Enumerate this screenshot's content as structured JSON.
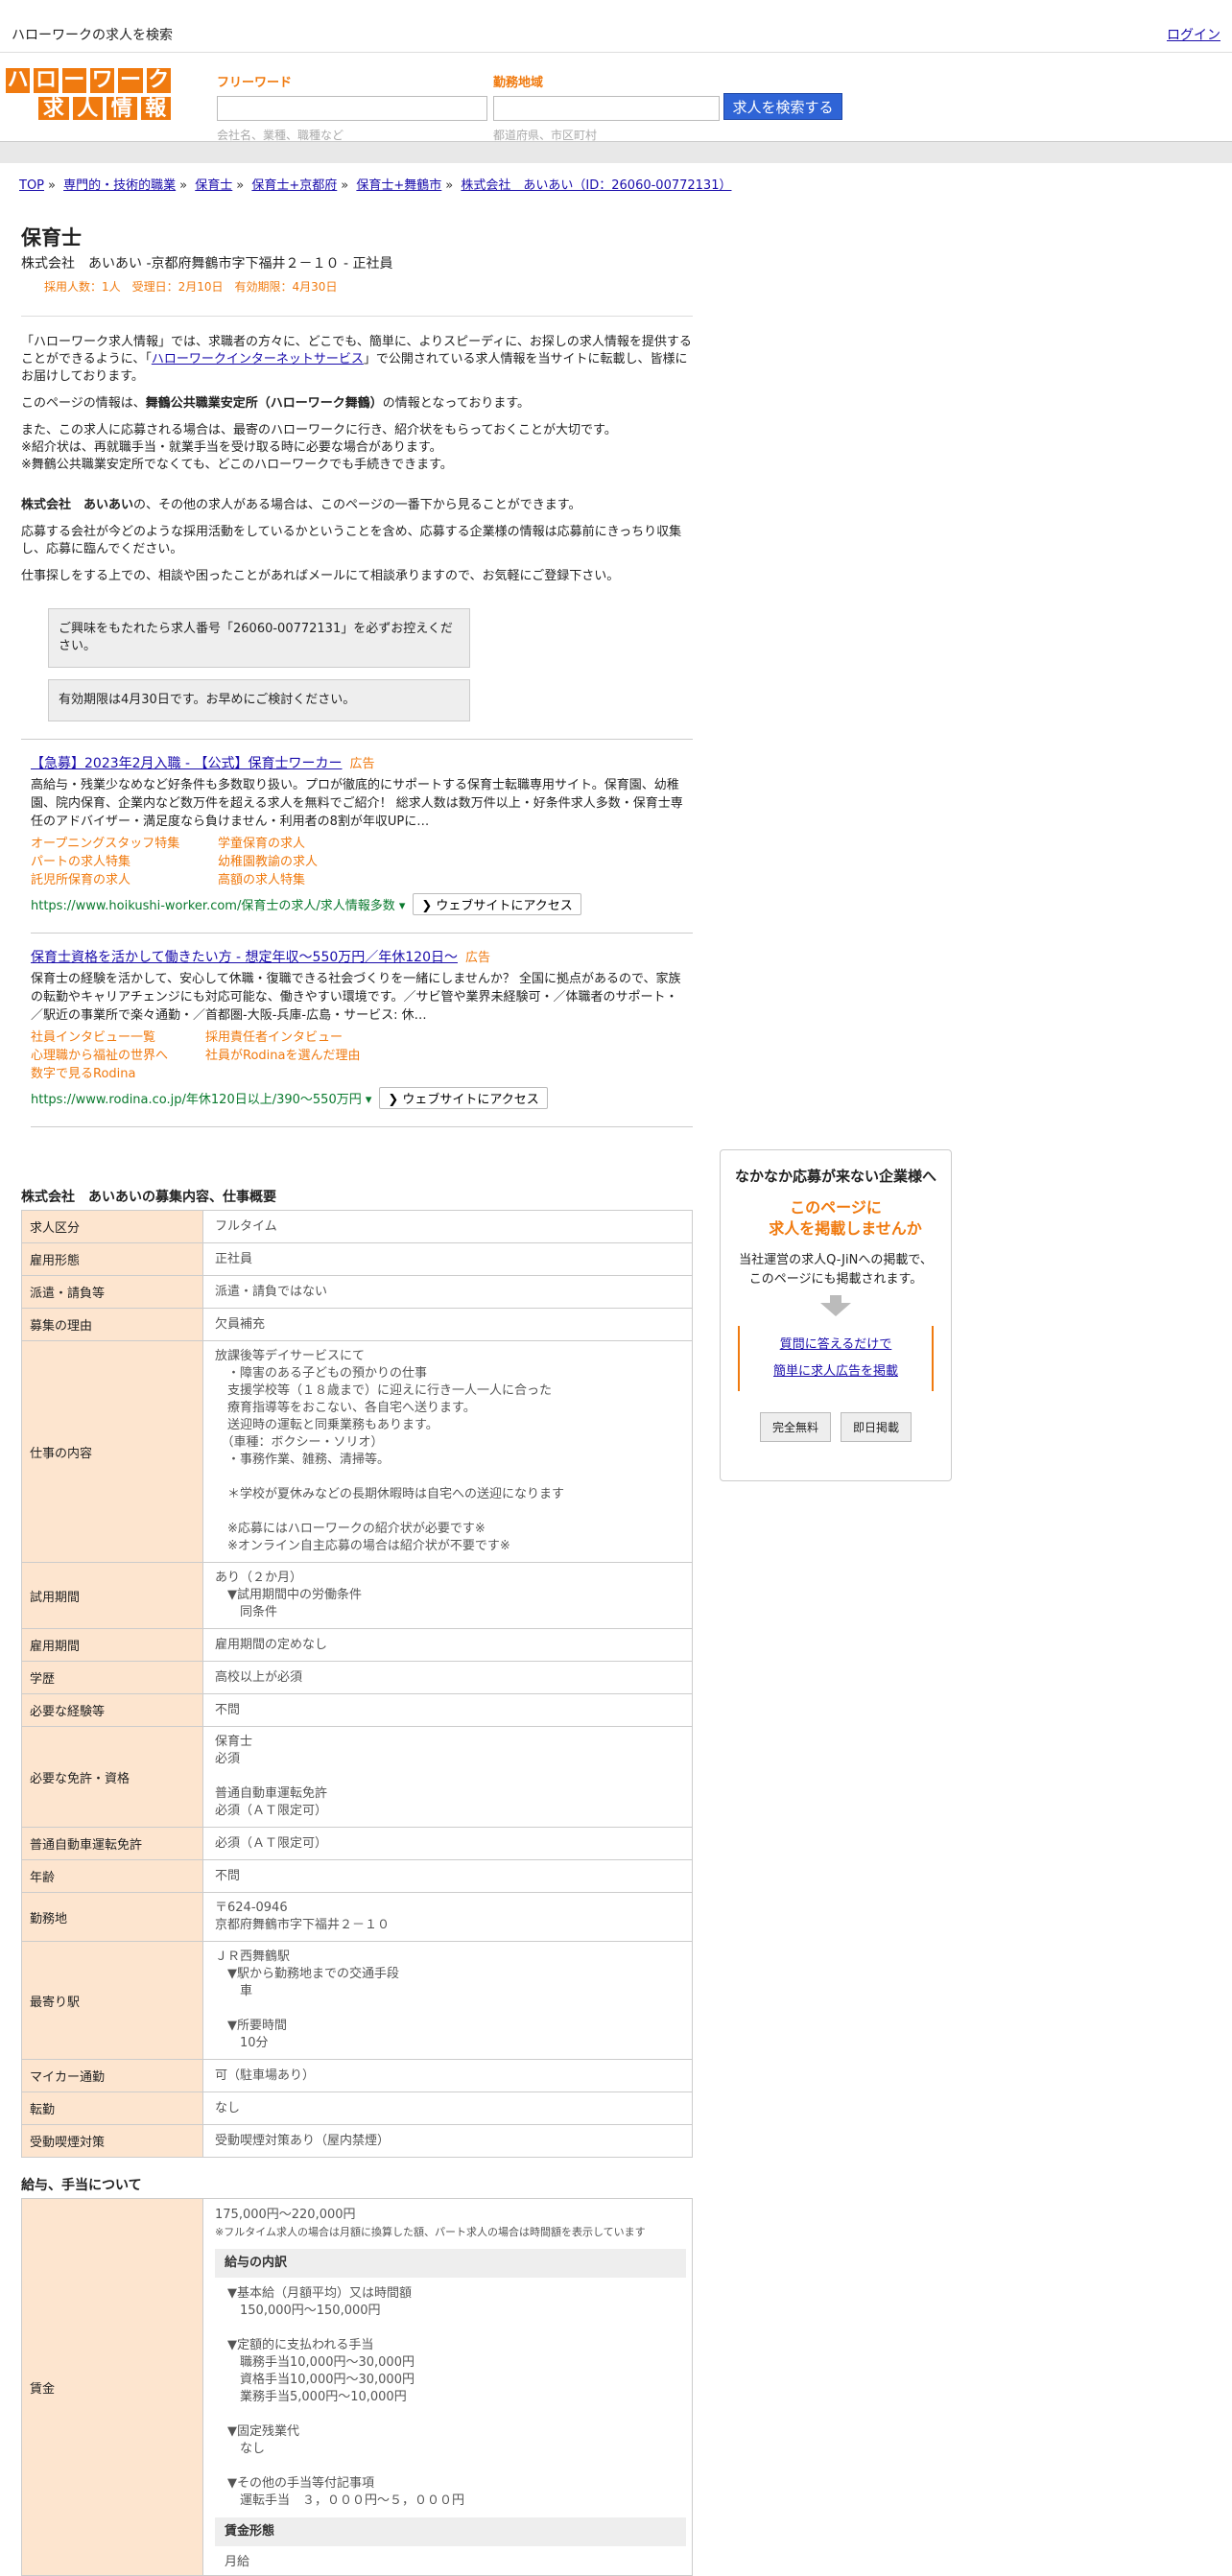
{
  "topbar": {
    "brand": "ハローワークの求人を検索",
    "login": "ログイン"
  },
  "logo": {
    "row1": [
      "ハ",
      "ロ",
      "ー",
      "ワ",
      "ー",
      "ク"
    ],
    "row2": [
      "求",
      "人",
      "情",
      "報"
    ]
  },
  "search": {
    "freeword_label": "フリーワード",
    "freeword_hint": "会社名、業種、職種など",
    "area_label": "勤務地域",
    "area_hint": "都道府県、市区町村",
    "button": "求人を検索する"
  },
  "breadcrumb": [
    "TOP",
    "専門的・技術的職業",
    "保育士",
    "保育士+京都府",
    "保育士+舞鶴市",
    "株式会社　あいあい（ID：26060-00772131）"
  ],
  "job": {
    "title": "保育士",
    "company_line": "株式会社　あいあい -京都府舞鶴市字下福井２－１０ - 正社員",
    "meta": "採用人数：1人　受理日：2月10日　有効期限：4月30日"
  },
  "info": {
    "p1_pre": "「ハローワーク求人情報」では、求職者の方々に、どこでも、簡単に、よりスピーディに、お探しの求人情報を提供することができるように、「",
    "p1_link": "ハローワークインターネットサービス",
    "p1_post": "」で公開されている求人情報を当サイトに転載し、皆様にお届けしております。",
    "p2_pre": "このページの情報は、",
    "p2_bold": "舞鶴公共職業安定所（ハローワーク舞鶴）",
    "p2_post": "の情報となっております。",
    "p3a": "また、この求人に応募される場合は、最寄のハローワークに行き、紹介状をもらっておくことが大切です。",
    "p3b": "※紹介状は、再就職手当・就業手当を受け取る時に必要な場合があります。",
    "p3c": "※舞鶴公共職業安定所でなくても、どこのハローワークでも手続きできます。",
    "p4_bold": "株式会社　あいあい",
    "p4_post": "の、その他の求人がある場合は、このページの一番下から見ることができます。",
    "p5": "応募する会社が今どのような採用活動をしているかということを含め、応募する企業様の情報は応募前にきっちり収集し、応募に臨んでください。",
    "p6": "仕事探しをする上での、相談や困ったことがあればメールにて相談承りますので、お気軽にご登録下さい。",
    "notice1": "ご興味をもたれたら求人番号「26060-00772131」を必ずお控えください。",
    "notice2": "有効期限は4月30日です。お早めにご検討ください。"
  },
  "ads": [
    {
      "title": "【急募】2023年2月入職 - 【公式】保育士ワーカー",
      "badge": "広告",
      "desc": "高給与・残業少なめなど好条件も多数取り扱い。プロが徹底的にサポートする保育士転職専用サイト。保育園、幼稚園、院内保育、企業内など数万件を超える求人を無料でご紹介！ 総求人数は数万件以上・好条件求人多数・保育士専任のアドバイザー・満足度なら負けません・利用者の8割が年収UPに…",
      "links": [
        "オープニングスタッフ特集",
        "学童保育の求人",
        "パートの求人特集",
        "幼稚園教諭の求人",
        "託児所保育の求人",
        "高額の求人特集"
      ],
      "url": "https://www.hoikushi-worker.com/保育士の求人/求人情報多数 ▾",
      "visit": "❯ ウェブサイトにアクセス"
    },
    {
      "title": "保育士資格を活かして働きたい方 - 想定年収～550万円／年休120日～",
      "badge": "広告",
      "desc": "保育士の経験を活かして、安心して休職・復職できる社会づくりを一緒にしませんか？ 全国に拠点があるので、家族の転勤やキャリアチェンジにも対応可能な、働きやすい環境です。／サビ管や業界未経験可・／体職者のサポート・／駅近の事業所で楽々通勤・／首都圏-大阪-兵庫-広島・サービス: 休…",
      "links": [
        "社員インタビュー一覧",
        "採用責任者インタビュー",
        "心理職から福祉の世界へ",
        "社員がRodinaを選んだ理由",
        "数字で見るRodina",
        ""
      ],
      "url": "https://www.rodina.co.jp/年休120日以上/390～550万円 ▾",
      "visit": "❯ ウェブサイトにアクセス"
    }
  ],
  "spec": {
    "heading": "株式会社　あいあいの募集内容、仕事概要",
    "rows": [
      {
        "k": "求人区分",
        "v": "フルタイム"
      },
      {
        "k": "雇用形態",
        "v": "正社員"
      },
      {
        "k": "派遣・請負等",
        "v": "派遣・請負ではない"
      },
      {
        "k": "募集の理由",
        "v": "欠員補充"
      },
      {
        "k": "仕事の内容",
        "v": "放課後等デイサービスにて\n　・障害のある子どもの預かりの仕事\n　支援学校等（１８歳まで）に迎えに行き一人一人に合った\n　療育指導等をおこない、各自宅へ送ります。\n　送迎時の運転と同乗業務もあります。\n　（車種：ボクシー・ソリオ）\n　・事務作業、雑務、清掃等。\n\n　＊学校が夏休みなどの長期休暇時は自宅への送迎になります\n\n　※応募にはハローワークの紹介状が必要です※\n　※オンライン自主応募の場合は紹介状が不要です※"
      },
      {
        "k": "試用期間",
        "v": "あり（２か月）\n　▼試用期間中の労働条件\n　　同条件"
      },
      {
        "k": "雇用期間",
        "v": "雇用期間の定めなし"
      },
      {
        "k": "学歴",
        "v": "高校以上が必須"
      },
      {
        "k": "必要な経験等",
        "v": "不問"
      },
      {
        "k": "必要な免許・資格",
        "v": "保育士\n必須\n\n普通自動車運転免許\n必須（ＡＴ限定可）"
      },
      {
        "k": "普通自動車運転免許",
        "v": "必須（ＡＴ限定可）"
      },
      {
        "k": "年齢",
        "v": "不問"
      },
      {
        "k": "勤務地",
        "v": "〒624-0946\n京都府舞鶴市字下福井２－１０"
      },
      {
        "k": "最寄り駅",
        "v": "ＪＲ西舞鶴駅\n　▼駅から勤務地までの交通手段\n　　車\n\n　▼所要時間\n　　10分"
      },
      {
        "k": "マイカー通勤",
        "v": "可（駐車場あり）"
      },
      {
        "k": "転勤",
        "v": "なし"
      },
      {
        "k": "受動喫煙対策",
        "v": "受動喫煙対策あり（屋内禁煙）"
      }
    ]
  },
  "salary": {
    "heading": "給与、手当について",
    "label": "賃金",
    "range": "175,000円〜220,000円",
    "note": "※フルタイム求人の場合は月額に換算した額、パート求人の場合は時間額を表示しています",
    "sub1": "給与の内訳",
    "detail": "　▼基本給（月額平均）又は時間額\n　　150,000円〜150,000円\n\n　▼定額的に支払われる手当\n　　職務手当10,000円〜30,000円\n　　資格手当10,000円〜30,000円\n　　業務手当5,000円〜10,000円\n\n　▼固定残業代\n　　なし\n\n　▼その他の手当等付記事項\n　　運転手当　３，０００円～５，０００円",
    "sub2": "賃金形態",
    "form": "月給"
  },
  "side": {
    "t1": "なかなか応募が来ない企業様へ",
    "t2a": "このページに",
    "t2b": "求人を掲載しませんか",
    "t3a": "当社運営の求人Q-JiNへの掲載で、",
    "t3b": "このページにも掲載されます。",
    "link1": "質問に答えるだけで",
    "link2": "簡単に求人広告を掲載",
    "btn1": "完全無料",
    "btn2": "即日掲載"
  },
  "colors": {
    "accent_orange": "#f07a0f",
    "search_button": "#2f64d6",
    "table_header": "#fde5cf",
    "ad_url_green": "#0a7a2e"
  }
}
